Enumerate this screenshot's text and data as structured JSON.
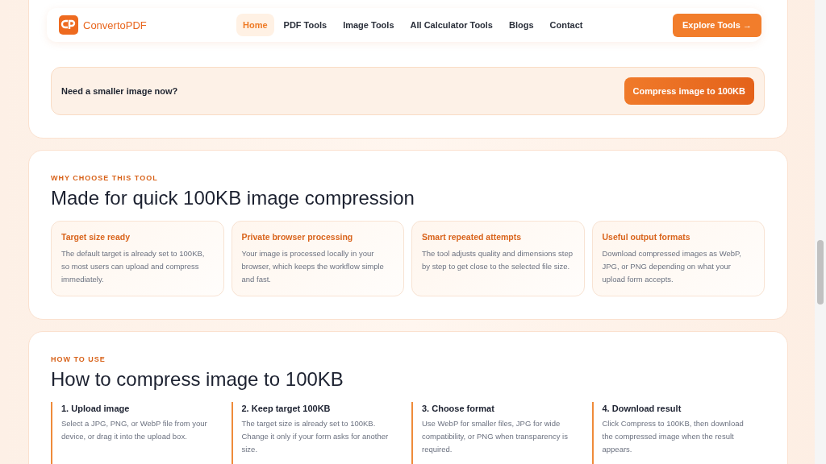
{
  "header": {
    "brand": "ConvertoPDF",
    "nav": [
      {
        "label": "Home",
        "selected": true
      },
      {
        "label": "PDF Tools",
        "selected": false
      },
      {
        "label": "Image Tools",
        "selected": false
      },
      {
        "label": "All Calculator Tools",
        "selected": false
      },
      {
        "label": "Blogs",
        "selected": false
      },
      {
        "label": "Contact",
        "selected": false
      }
    ],
    "cta": "Explore Tools →"
  },
  "cta_banner": {
    "text": "Need a smaller image now?",
    "button": "Compress image to 100KB"
  },
  "why": {
    "eyebrow": "WHY CHOOSE THIS TOOL",
    "title": "Made for quick 100KB image compression",
    "cards": [
      {
        "title": "Target size ready",
        "text": "The default target is already set to 100KB, so most users can upload and compress immediately."
      },
      {
        "title": "Private browser processing",
        "text": "Your image is processed locally in your browser, which keeps the workflow simple and fast."
      },
      {
        "title": "Smart repeated attempts",
        "text": "The tool adjusts quality and dimensions step by step to get close to the selected file size."
      },
      {
        "title": "Useful output formats",
        "text": "Download compressed images as WebP, JPG, or PNG depending on what your upload form accepts."
      }
    ]
  },
  "how": {
    "eyebrow": "HOW TO USE",
    "title": "How to compress image to 100KB",
    "steps": [
      {
        "title": "1. Upload image",
        "text": "Select a JPG, PNG, or WebP file from your device, or drag it into the upload box."
      },
      {
        "title": "2. Keep target 100KB",
        "text": "The target size is already set to 100KB. Change it only if your form asks for another size."
      },
      {
        "title": "3. Choose format",
        "text": "Use WebP for smaller files, JPG for wide compatibility, or PNG when transparency is required."
      },
      {
        "title": "4. Download result",
        "text": "Click Compress to 100KB, then download the compressed image when the result appears."
      }
    ]
  }
}
